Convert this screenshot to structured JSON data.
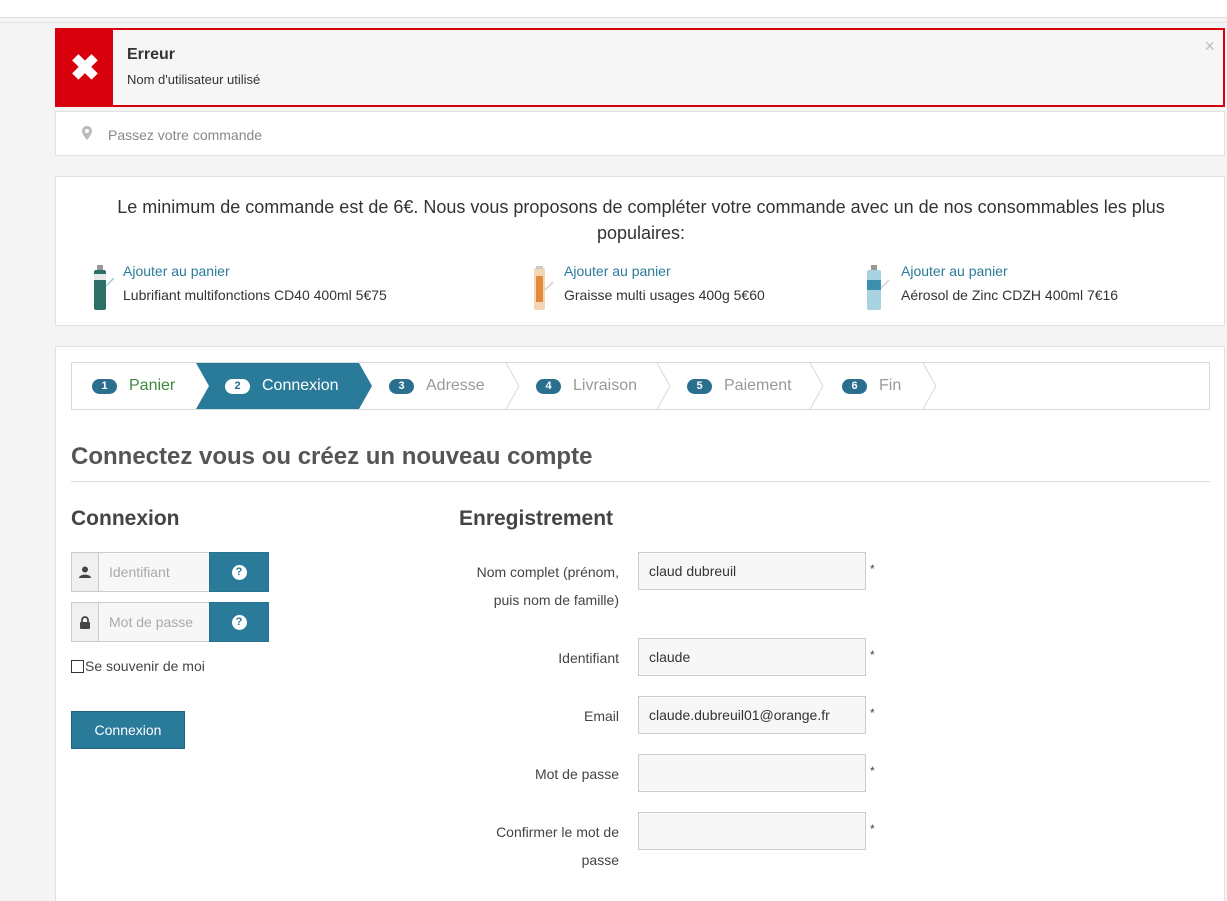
{
  "alert": {
    "title": "Erreur",
    "message": "Nom d'utilisateur utilisé",
    "close_glyph": "×",
    "icon_glyph": "✖"
  },
  "breadcrumb": {
    "icon": "map-marker-icon",
    "text": "Passez votre commande"
  },
  "promo": {
    "message": "Le minimum de commande est de 6€. Nous vous proposons de compléter votre commande avec un de nos consommables les plus populaires:",
    "products": [
      {
        "link": "Ajouter au panier",
        "name": "Lubrifiant multifonctions CD40 400ml 5€75"
      },
      {
        "link": "Ajouter au panier",
        "name": "Graisse multi usages 400g 5€60"
      },
      {
        "link": "Ajouter au panier",
        "name": "Aérosol de Zinc CDZH 400ml 7€16"
      }
    ]
  },
  "steps": [
    {
      "num": "1",
      "label": "Panier",
      "state": "done"
    },
    {
      "num": "2",
      "label": "Connexion",
      "state": "active"
    },
    {
      "num": "3",
      "label": "Adresse",
      "state": "todo"
    },
    {
      "num": "4",
      "label": "Livraison",
      "state": "todo"
    },
    {
      "num": "5",
      "label": "Paiement",
      "state": "todo"
    },
    {
      "num": "6",
      "label": "Fin",
      "state": "todo"
    }
  ],
  "page_title": "Connectez vous ou créez un nouveau compte",
  "login": {
    "title": "Connexion",
    "username_placeholder": "Identifiant",
    "password_placeholder": "Mot de passe",
    "help_glyph": "?",
    "remember_label": "Se souvenir de moi",
    "submit_label": "Connexion"
  },
  "register": {
    "title": "Enregistrement",
    "required_mark": "*",
    "fields": [
      {
        "label_line1": "Nom complet (prénom,",
        "label_line2": "puis nom de famille)",
        "value": "claud dubreuil"
      },
      {
        "label_line1": "Identifiant",
        "value": "claude"
      },
      {
        "label_line1": "Email",
        "value": "claude.dubreuil01@orange.fr"
      },
      {
        "label_line1": "Mot de passe",
        "value": ""
      },
      {
        "label_line1": "Confirmer le mot de",
        "label_line2": "passe",
        "value": ""
      }
    ]
  },
  "colors": {
    "error": "#d9000d",
    "primary": "#2a7a9a",
    "step_done": "#3c8a3c"
  }
}
